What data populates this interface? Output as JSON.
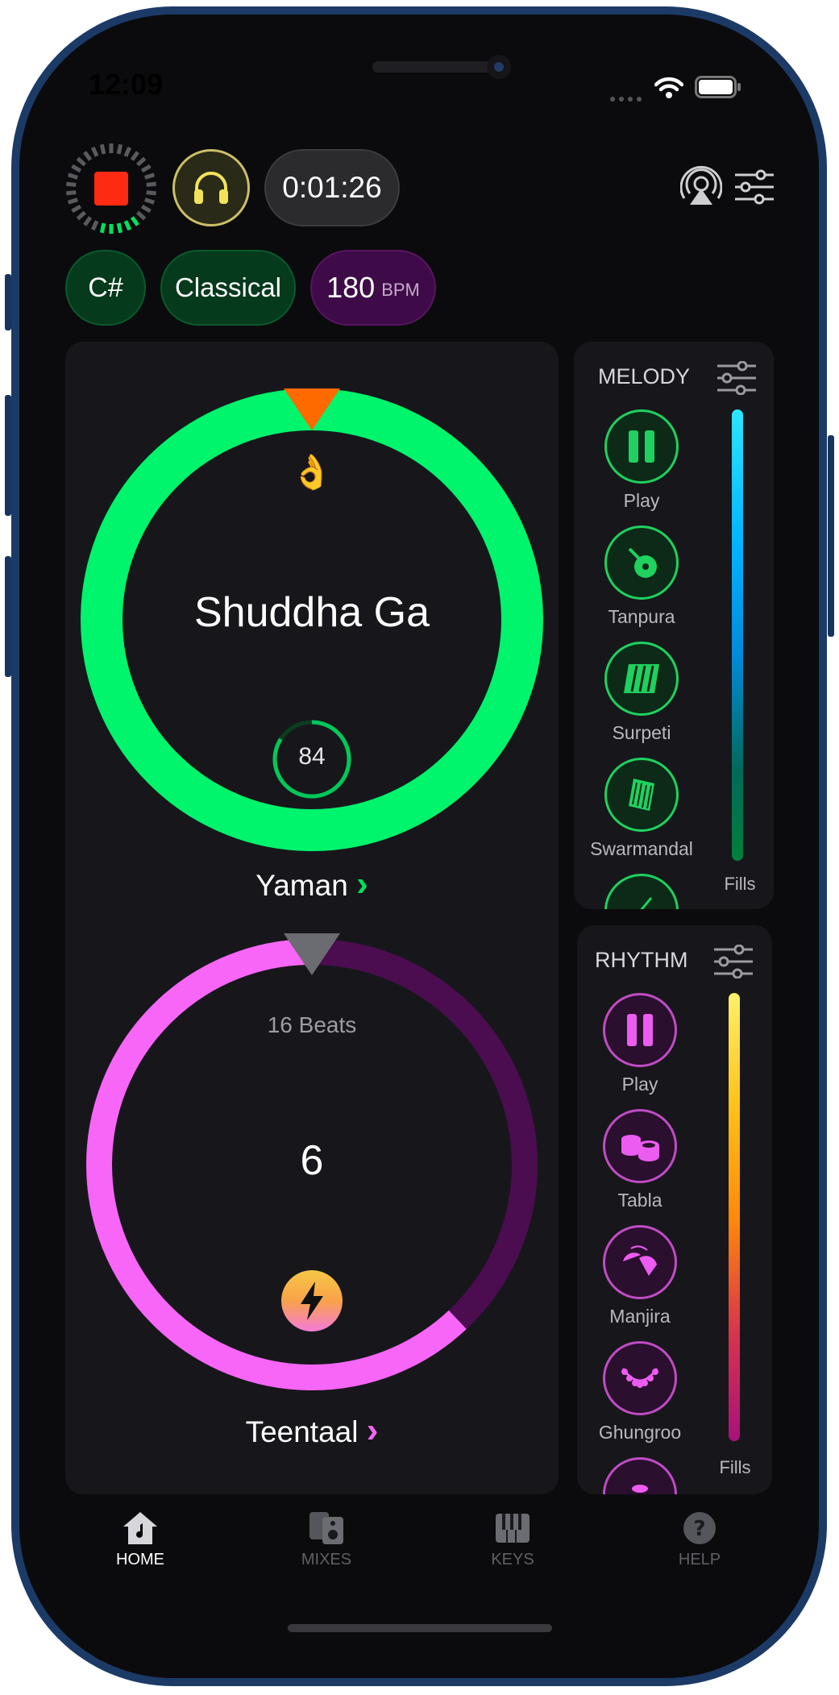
{
  "status_bar": {
    "time": "12:09"
  },
  "header": {
    "timer": "0:01:26",
    "key": "C#",
    "genre": "Classical",
    "bpm_value": "180",
    "bpm_unit": "BPM",
    "icons": [
      "record-stop-icon",
      "headphones-icon",
      "airplay-icon",
      "sliders-icon"
    ]
  },
  "melody_wheel": {
    "note": "Shuddha Ga",
    "emoji": "👌",
    "tuning_value": "84",
    "raga": "Yaman",
    "raga_arrow": "›",
    "ring_color": "#00f46c",
    "marker_color": "#ff6a00"
  },
  "rhythm_wheel": {
    "beats_label": "16 Beats",
    "beat": "6",
    "taal": "Teentaal",
    "taal_arrow": "›",
    "ring_color": "#f766f7",
    "track_color": "#4b0d4f",
    "progress": 0.38
  },
  "melody_panel": {
    "title": "MELODY",
    "items": [
      {
        "label": "Play",
        "icon": "pause-icon"
      },
      {
        "label": "Tanpura",
        "icon": "tanpura-icon"
      },
      {
        "label": "Surpeti",
        "icon": "surpeti-icon"
      },
      {
        "label": "Swarmandal",
        "icon": "swarmandal-icon"
      }
    ],
    "fills_label": "Fills",
    "accent": "#1fd15f"
  },
  "rhythm_panel": {
    "title": "RHYTHM",
    "items": [
      {
        "label": "Play",
        "icon": "pause-icon"
      },
      {
        "label": "Tabla",
        "icon": "tabla-icon"
      },
      {
        "label": "Manjira",
        "icon": "manjira-icon"
      },
      {
        "label": "Ghungroo",
        "icon": "ghungroo-icon"
      }
    ],
    "fills_label": "Fills",
    "accent": "#e04ee6"
  },
  "tab_bar": {
    "items": [
      {
        "label": "HOME",
        "icon": "home-music-icon",
        "active": true
      },
      {
        "label": "MIXES",
        "icon": "mixes-icon",
        "active": false
      },
      {
        "label": "KEYS",
        "icon": "keys-icon",
        "active": false
      },
      {
        "label": "HELP",
        "icon": "help-icon",
        "active": false
      }
    ]
  }
}
